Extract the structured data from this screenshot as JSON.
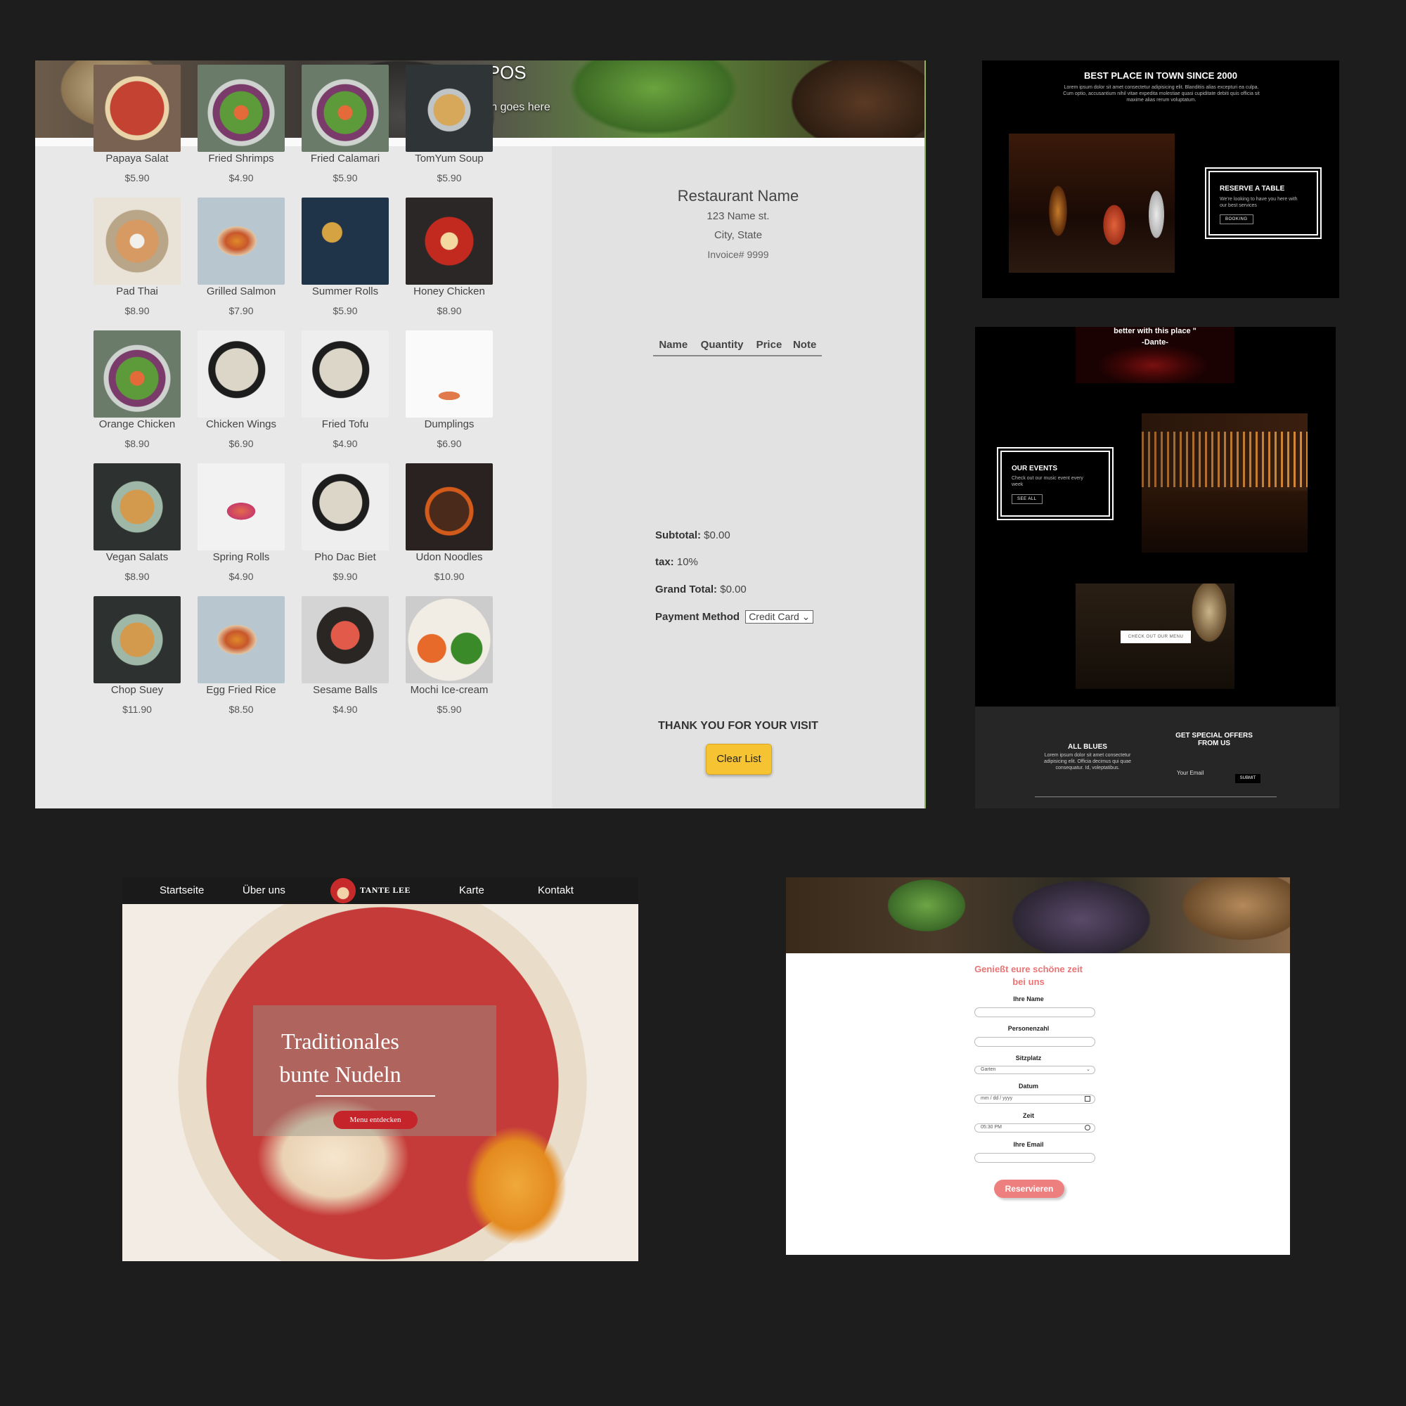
{
  "pos": {
    "title": "Vfresh POS",
    "slogan": "Restaurant slogan goes here",
    "items": [
      {
        "name": "Papaya Salat",
        "price": "$5.90",
        "img": "pizza"
      },
      {
        "name": "Fried Shrimps",
        "price": "$4.90",
        "img": "salad"
      },
      {
        "name": "Fried Calamari",
        "price": "$5.90",
        "img": "salad"
      },
      {
        "name": "TomYum Soup",
        "price": "$5.90",
        "img": "noodle"
      },
      {
        "name": "Pad Thai",
        "price": "$8.90",
        "img": "bowl"
      },
      {
        "name": "Grilled Salmon",
        "price": "$7.90",
        "img": "burger"
      },
      {
        "name": "Summer Rolls",
        "price": "$5.90",
        "img": "rolls"
      },
      {
        "name": "Honey Chicken",
        "price": "$8.90",
        "img": "ramen"
      },
      {
        "name": "Orange Chicken",
        "price": "$8.90",
        "img": "salad"
      },
      {
        "name": "Chicken Wings",
        "price": "$6.90",
        "img": "soup"
      },
      {
        "name": "Fried Tofu",
        "price": "$4.90",
        "img": "soup"
      },
      {
        "name": "Dumplings",
        "price": "$6.90",
        "img": "plate"
      },
      {
        "name": "Vegan Salats",
        "price": "$8.90",
        "img": "vegan"
      },
      {
        "name": "Spring Rolls",
        "price": "$4.90",
        "img": "spring"
      },
      {
        "name": "Pho Dac Biet",
        "price": "$9.90",
        "img": "soup"
      },
      {
        "name": "Udon Noodles",
        "price": "$10.90",
        "img": "grill"
      },
      {
        "name": "Chop Suey",
        "price": "$11.90",
        "img": "vegan"
      },
      {
        "name": "Egg Fried Rice",
        "price": "$8.50",
        "img": "burger"
      },
      {
        "name": "Sesame Balls",
        "price": "$4.90",
        "img": "tuna"
      },
      {
        "name": "Mochi Ice-cream",
        "price": "$5.90",
        "img": "platter"
      }
    ],
    "receipt": {
      "restaurant_name": "Restaurant Name",
      "address": "123 Name st.",
      "city": "City, State",
      "invoice": "Invoice# 9999",
      "columns": [
        "Name",
        "Quantity",
        "Price",
        "Note"
      ],
      "subtotal_label": "Subtotal:",
      "subtotal_value": "$0.00",
      "tax_label": "tax:",
      "tax_value": "10%",
      "grand_total_label": "Grand Total:",
      "grand_total_value": "$0.00",
      "payment_label": "Payment Method",
      "payment_value": "Credit Card",
      "thank_you": "THANK YOU FOR YOUR VISIT",
      "clear_button": "Clear List"
    }
  },
  "bar1": {
    "heading": "BEST PLACE IN TOWN SINCE 2000",
    "intro": "Lorem ipsum dolor sit amet consectetur adipisicing elit. Blanditiis alias excepturi ea culpa. Cum optio, accusantium nihil vitae expedita molestiae quasi cupiditate debiti quis officia sit maxime alias rerum voluptatum.",
    "reserve_title": "RESERVE A TABLE",
    "reserve_text": "We're looking to have you here with our best services",
    "reserve_button": "BOOKING"
  },
  "bar2": {
    "quote": "better with this place \"",
    "quote_author": "-Dante-",
    "events_title": "OUR EVENTS",
    "events_text": "Check out our music event every week",
    "events_button": "SEE ALL",
    "menu_button": "CHECK OUT OUR MENU",
    "footer_left_title": "ALL BLUES",
    "footer_left_text": "Lorem ipsum dolor sit amet consectetur adipisicing elit. Officia decimus qui quae consequatur. Id, voleptatibus.",
    "footer_right_title": "GET SPECIAL OFFERS FROM US",
    "email_placeholder": "Your Email",
    "submit_button": "SUBMIT"
  },
  "lee": {
    "nav": [
      "Startseite",
      "Über uns",
      "Karte",
      "Kontakt"
    ],
    "logo": "TANTE LEE",
    "hero_title": "Traditionales bunte Nudeln",
    "hero_button": "Menu entdecken"
  },
  "res": {
    "heading": "Genießt eure schöne zeit bei uns",
    "name_label": "Ihre Name",
    "people_label": "Personenzahl",
    "seat_label": "Sitzplatz",
    "seat_value": "Garten",
    "date_label": "Datum",
    "date_placeholder": "mm / dd / yyyy",
    "time_label": "Zeit",
    "time_value": "05:30 PM",
    "email_label": "Ihre Email",
    "submit": "Reservieren"
  }
}
